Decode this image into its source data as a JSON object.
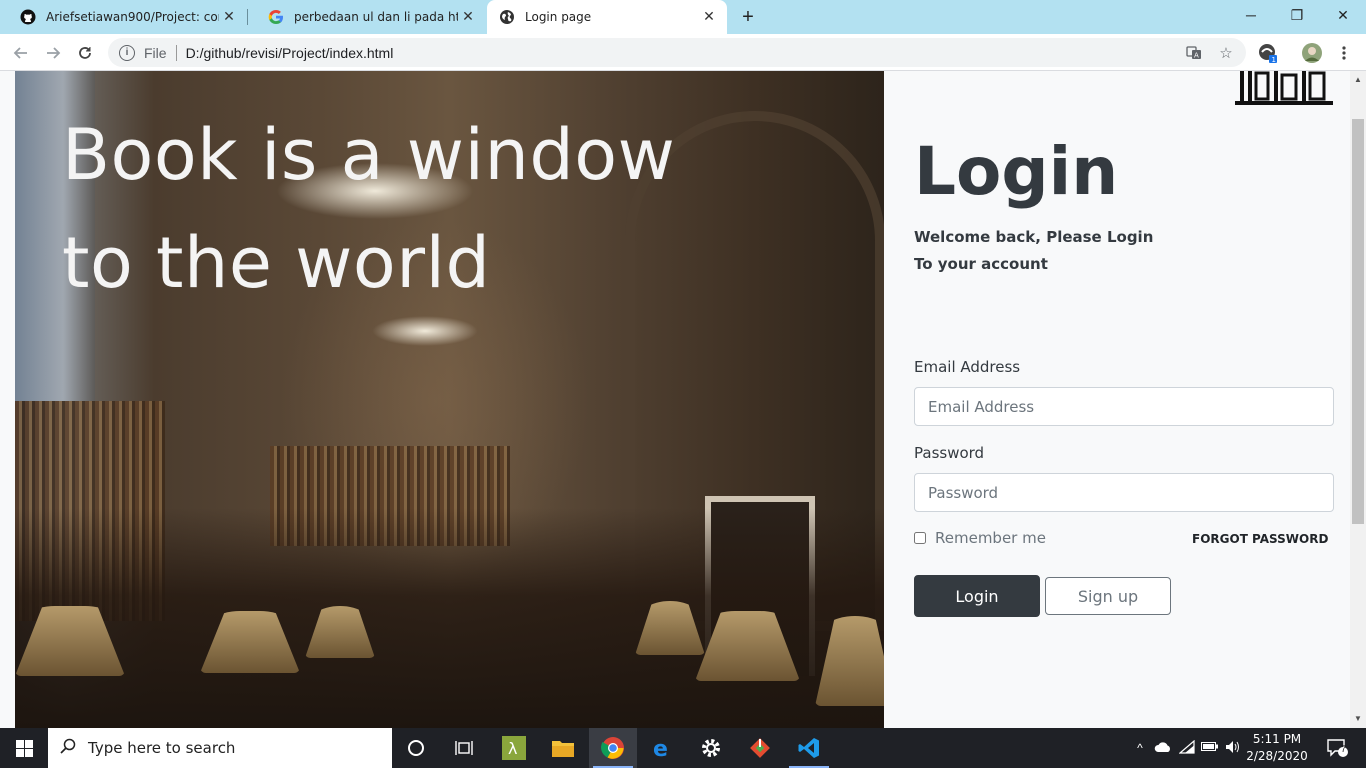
{
  "browser": {
    "tabs": [
      {
        "title": "Ariefsetiawan900/Project: contin",
        "icon": "github-icon",
        "active": false
      },
      {
        "title": "perbedaan ul dan li pada html - G",
        "icon": "google-icon",
        "active": false
      },
      {
        "title": "Login page",
        "icon": "globe-icon",
        "active": true
      }
    ],
    "new_tab_label": "+",
    "window_controls": [
      "─",
      "❐",
      "✕"
    ],
    "address": {
      "security_label": "File",
      "url": "D:/github/revisi/Project/index.html"
    }
  },
  "page": {
    "hero": {
      "line1": "Book is a window",
      "line2": "to the world"
    },
    "login": {
      "title": "Login",
      "welcome_line1": "Welcome back, Please Login",
      "welcome_line2": "To your account",
      "email_label": "Email Address",
      "email_placeholder": "Email Address",
      "password_label": "Password",
      "password_placeholder": "Password",
      "remember_label": "Remember me",
      "forgot_label": "FORGOT PASSWORD",
      "login_button": "Login",
      "signup_button": "Sign up"
    }
  },
  "taskbar": {
    "search_placeholder": "Type here to search",
    "time": "5:11 PM",
    "date": "2/28/2020",
    "notification_count": "7"
  },
  "colors": {
    "tabstrip": "#b3e1f1",
    "dark_button": "#343a40",
    "panel_bg": "#f8f9fa",
    "taskbar": "#1f2126"
  }
}
